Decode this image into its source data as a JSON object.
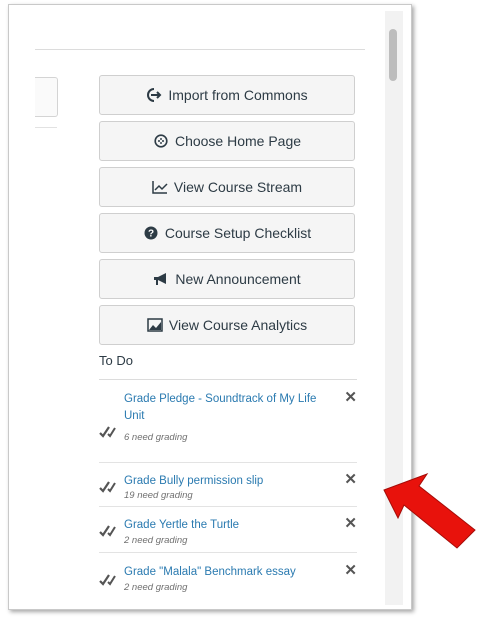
{
  "buttons": [
    {
      "label": "Import from Commons",
      "icon": "import-icon"
    },
    {
      "label": "Choose Home Page",
      "icon": "home-circle-icon"
    },
    {
      "label": "View Course Stream",
      "icon": "stream-chart-icon"
    },
    {
      "label": "Course Setup Checklist",
      "icon": "question-circle-icon"
    },
    {
      "label": "New Announcement",
      "icon": "megaphone-icon"
    },
    {
      "label": "View Course Analytics",
      "icon": "analytics-icon"
    }
  ],
  "todo": {
    "title": "To Do",
    "items": [
      {
        "title": "Grade Pledge - Soundtrack of My Life Unit",
        "sub": "6 need grading"
      },
      {
        "title": "Grade Bully permission slip",
        "sub": "19 need grading"
      },
      {
        "title": "Grade Yertle the Turtle",
        "sub": "2 need grading"
      },
      {
        "title": "Grade \"Malala\" Benchmark essay",
        "sub": "2 need grading"
      }
    ]
  },
  "colors": {
    "link": "#2a7ab0",
    "arrow": "#e8120c",
    "button_bg": "#f5f5f5"
  }
}
